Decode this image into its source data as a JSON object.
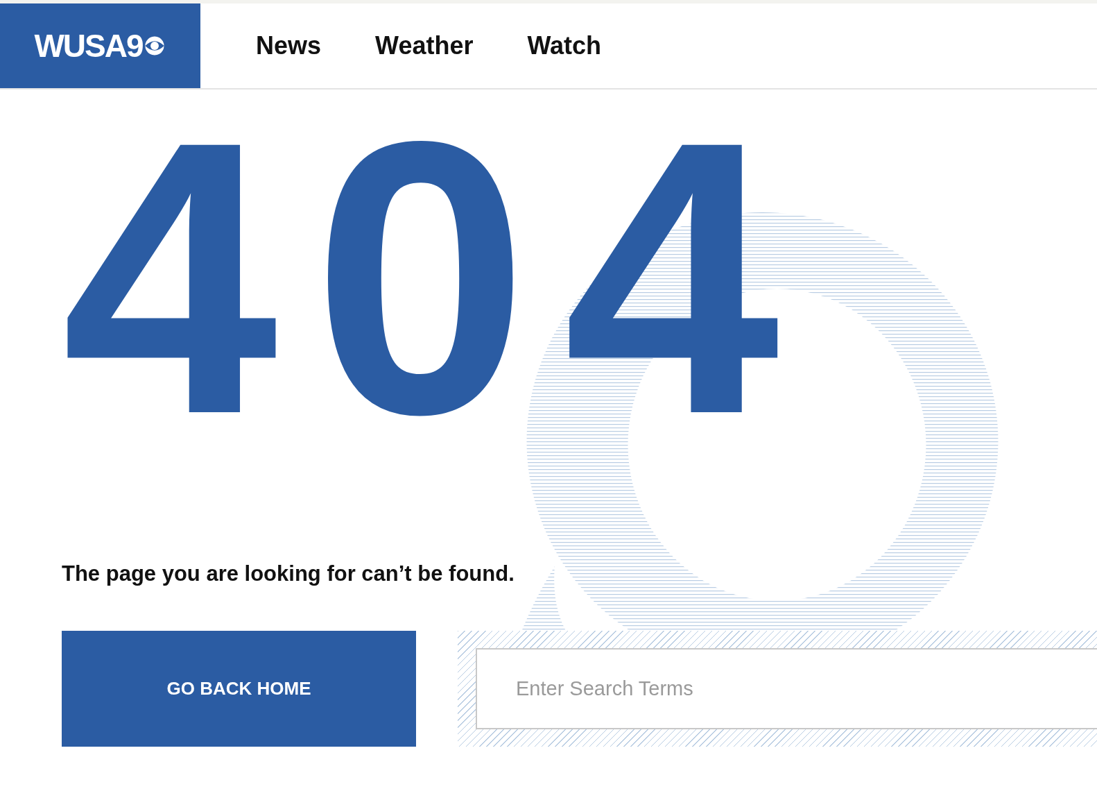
{
  "header": {
    "logo": {
      "text": "WUSA9"
    },
    "nav": [
      {
        "label": "News"
      },
      {
        "label": "Weather"
      },
      {
        "label": "Watch"
      }
    ]
  },
  "error": {
    "code": "404",
    "message": "The page you are looking for can’t be found."
  },
  "home_button": {
    "label": "GO BACK HOME"
  },
  "search": {
    "placeholder": "Enter Search Terms"
  }
}
